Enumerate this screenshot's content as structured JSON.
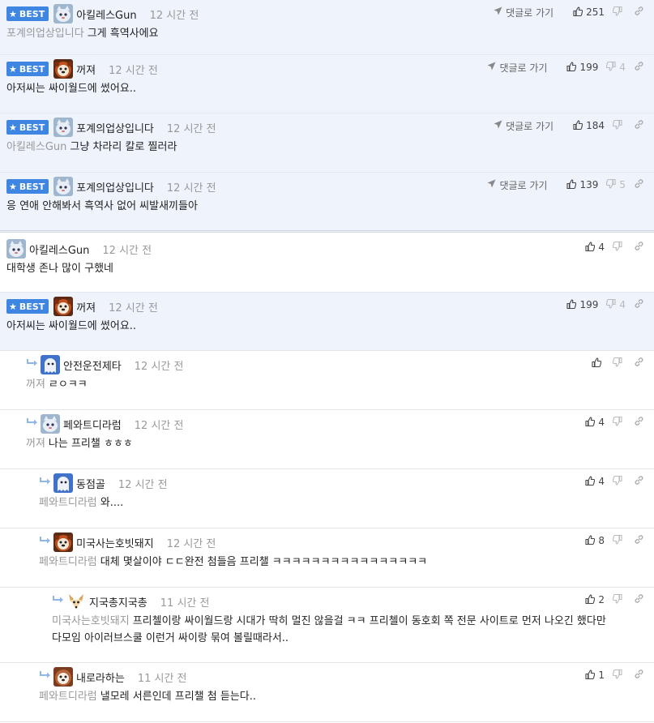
{
  "labels": {
    "best": "BEST",
    "goto": "댓글로 가기"
  },
  "comments": [
    {
      "best": true,
      "avatar": "cat",
      "nick": "아킬레스Gun",
      "time": "12 시간 전",
      "ref": "포계의업상입니다",
      "text": "그게 흑역사에요",
      "goto": true,
      "likes": "251",
      "dislikes": ""
    },
    {
      "best": true,
      "avatar": "dog",
      "nick": "꺼져",
      "time": "12 시간 전",
      "ref": "",
      "text": "아저씨는 싸이월드에 썼어요..",
      "goto": true,
      "likes": "199",
      "dislikes": "4"
    },
    {
      "best": true,
      "avatar": "cat",
      "nick": "포계의업상입니다",
      "time": "12 시간 전",
      "ref": "아킬레스Gun",
      "text": "그냥 차라리 칼로 찔러라",
      "goto": true,
      "likes": "184",
      "dislikes": ""
    },
    {
      "best": true,
      "avatar": "cat",
      "nick": "포계의업상입니다",
      "time": "12 시간 전",
      "ref": "",
      "text": "응 연애 안해봐서 흑역사 없어 씨발새끼들아",
      "goto": true,
      "likes": "139",
      "dislikes": "5"
    },
    {
      "best": false,
      "avatar": "cat",
      "nick": "아킬레스Gun",
      "time": "12 시간 전",
      "ref": "",
      "text": "대학생 존나 많이 구했네",
      "goto": false,
      "likes": "4",
      "dislikes": ""
    },
    {
      "best": true,
      "avatar": "dog",
      "nick": "꺼져",
      "time": "12 시간 전",
      "ref": "",
      "text": "아저씨는 싸이월드에 썼어요..",
      "goto": false,
      "likes": "199",
      "dislikes": "4"
    },
    {
      "best": false,
      "avatar": "ghost",
      "nick": "안전운전제타",
      "time": "12 시간 전",
      "ref": "꺼져",
      "text": "ㄹㅇㅋㅋ",
      "goto": false,
      "likes": "",
      "dislikes": ""
    },
    {
      "best": false,
      "avatar": "cat",
      "nick": "페와트디라럼",
      "time": "12 시간 전",
      "ref": "꺼져",
      "text": "나는 프리챌 ㅎㅎㅎ",
      "goto": false,
      "likes": "4",
      "dislikes": ""
    },
    {
      "best": false,
      "avatar": "ghost",
      "nick": "동점골",
      "time": "12 시간 전",
      "ref": "페와트디라럼",
      "text": "와....",
      "goto": false,
      "likes": "4",
      "dislikes": ""
    },
    {
      "best": false,
      "avatar": "dog",
      "nick": "미국사는호빗돼지",
      "time": "12 시간 전",
      "ref": "페와트디라럼",
      "text": "대체 몇살이야 ㄷㄷ완전 첨들음 프리챌 ㅋㅋㅋㅋㅋㅋㅋㅋㅋㅋㅋㅋㅋㅋㅋㅋ",
      "goto": false,
      "likes": "8",
      "dislikes": ""
    },
    {
      "best": false,
      "avatar": "fox",
      "nick": "지국총지국총",
      "time": "11 시간 전",
      "ref": "미국사는호빗돼지",
      "text": "프리첼이랑 싸이월드랑 시대가 딱히 멀진 않을걸 ㅋㅋ 프리첼이 동호회 쪽 전문 사이트로 먼저 나오긴 했다만",
      "text2": "다모임 아이러브스쿨 이런거 싸이랑 묶여 볼릴때라서..",
      "goto": false,
      "likes": "2",
      "dislikes": ""
    },
    {
      "best": false,
      "avatar": "dog2",
      "nick": "내로라하는",
      "time": "11 시간 전",
      "ref": "페와트디라럼",
      "text": "낼모레 서른인데 프리챌 첨 듣는다..",
      "goto": false,
      "likes": "1",
      "dislikes": ""
    }
  ]
}
